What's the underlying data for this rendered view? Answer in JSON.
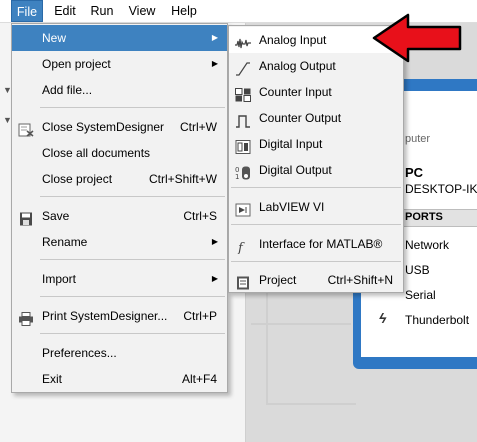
{
  "menubar": [
    "File",
    "Edit",
    "Run",
    "View",
    "Help"
  ],
  "file_menu": [
    {
      "label": "New",
      "shortcut": "",
      "submenu": true,
      "icon": ""
    },
    {
      "label": "Open project",
      "shortcut": "",
      "submenu": true,
      "icon": ""
    },
    {
      "label": "Add file...",
      "shortcut": "",
      "submenu": false,
      "icon": ""
    },
    {
      "label": "Close SystemDesigner",
      "shortcut": "Ctrl+W",
      "submenu": false,
      "icon": "close-doc-icon"
    },
    {
      "label": "Close all documents",
      "shortcut": "",
      "submenu": false,
      "icon": ""
    },
    {
      "label": "Close project",
      "shortcut": "Ctrl+Shift+W",
      "submenu": false,
      "icon": ""
    },
    {
      "label": "Save",
      "shortcut": "Ctrl+S",
      "submenu": false,
      "icon": "save-icon"
    },
    {
      "label": "Rename",
      "shortcut": "",
      "submenu": true,
      "icon": ""
    },
    {
      "label": "Import",
      "shortcut": "",
      "submenu": true,
      "icon": ""
    },
    {
      "label": "Print SystemDesigner...",
      "shortcut": "Ctrl+P",
      "submenu": false,
      "icon": "print-icon"
    },
    {
      "label": "Preferences...",
      "shortcut": "",
      "submenu": false,
      "icon": ""
    },
    {
      "label": "Exit",
      "shortcut": "Alt+F4",
      "submenu": false,
      "icon": ""
    }
  ],
  "new_submenu": [
    {
      "label": "Analog Input",
      "shortcut": "",
      "icon": "analog-input-icon"
    },
    {
      "label": "Analog Output",
      "shortcut": "",
      "icon": "analog-output-icon"
    },
    {
      "label": "Counter Input",
      "shortcut": "",
      "icon": "counter-input-icon"
    },
    {
      "label": "Counter Output",
      "shortcut": "",
      "icon": "counter-output-icon"
    },
    {
      "label": "Digital Input",
      "shortcut": "",
      "icon": "digital-input-icon"
    },
    {
      "label": "Digital Output",
      "shortcut": "",
      "icon": "digital-output-icon"
    },
    {
      "label": "LabVIEW VI",
      "shortcut": "",
      "icon": "labview-vi-icon"
    },
    {
      "label": "Interface for MATLAB®",
      "shortcut": "",
      "icon": "matlab-icon"
    },
    {
      "label": "Project",
      "shortcut": "Ctrl+Shift+N",
      "icon": "project-icon"
    }
  ],
  "background_panel": {
    "header_partial": "puter",
    "pc_label": "PC",
    "host": "DESKTOP-IK",
    "ports_label": "PORTS",
    "ports": [
      "Network",
      "USB",
      "Serial",
      "Thunderbolt"
    ]
  },
  "colors": {
    "highlight": "#3e82c0",
    "menu_bg": "#f2f2f2",
    "panel_blue": "#2f78c4",
    "annotation_arrow": "#e8101a"
  }
}
